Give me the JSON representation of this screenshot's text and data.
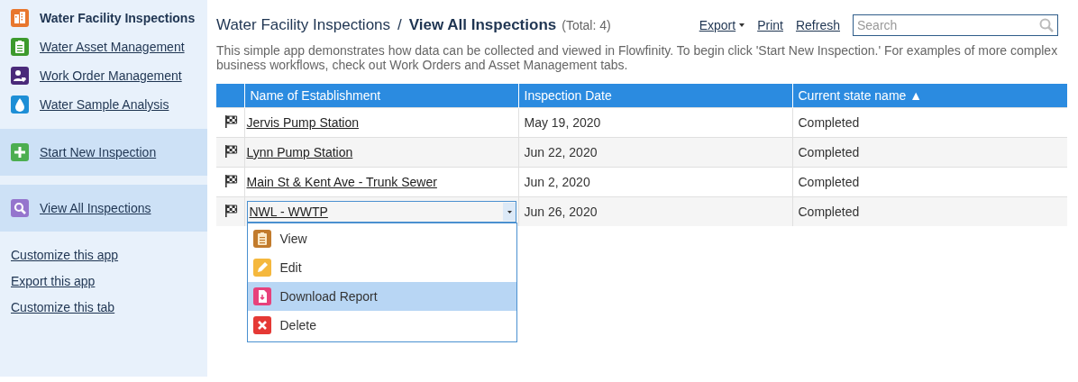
{
  "sidebar": {
    "apps": [
      {
        "label": "Water Facility Inspections",
        "kind": "building",
        "color": "#e8772e",
        "selected": true
      },
      {
        "label": "Water Asset Management",
        "kind": "clipboard",
        "color": "#3d9a2d",
        "selected": false
      },
      {
        "label": "Work Order Management",
        "kind": "person",
        "color": "#4a2a7a",
        "selected": false
      },
      {
        "label": "Water Sample Analysis",
        "kind": "drop",
        "color": "#1e8fd6",
        "selected": false
      }
    ],
    "actions": [
      {
        "label": "Start New Inspection",
        "kind": "add",
        "color": "#4cae50"
      },
      {
        "label": "View All Inspections",
        "kind": "search",
        "color": "#9575cd"
      }
    ],
    "links": [
      "Customize this app",
      "Export this app",
      "Customize this tab"
    ]
  },
  "header": {
    "breadcrumb": "Water Facility Inspections",
    "separator": "/",
    "title": "View All Inspections",
    "total": "(Total: 4)",
    "toolbar": [
      {
        "label": "Export",
        "has_menu": true
      },
      {
        "label": "Print",
        "has_menu": false
      },
      {
        "label": "Refresh",
        "has_menu": false
      }
    ],
    "search": {
      "placeholder": "Search"
    },
    "description": "This simple app demonstrates how data can be collected and viewed in Flowfinity. To begin click 'Start New Inspection.' For examples of more complex business workflows, check out Work Orders and Asset Management tabs."
  },
  "table": {
    "columns": [
      {
        "label": "Name of Establishment"
      },
      {
        "label": "Inspection Date"
      },
      {
        "label": "Current state name",
        "sort": "▲"
      }
    ],
    "rows": [
      {
        "name": "Jervis Pump Station",
        "date": "May 19, 2020",
        "state": "Completed",
        "menu_open": false
      },
      {
        "name": "Lynn Pump Station",
        "date": "Jun 22, 2020",
        "state": "Completed",
        "menu_open": false
      },
      {
        "name": "Main St & Kent Ave - Trunk Sewer",
        "date": "Jun 2, 2020",
        "state": "Completed",
        "menu_open": false
      },
      {
        "name": "NWL - WWTP",
        "date": "Jun 26, 2020",
        "state": "Completed",
        "menu_open": true
      }
    ]
  },
  "row_menu": {
    "items": [
      {
        "label": "View",
        "kind": "view",
        "color": "#c27b2c",
        "selected": false
      },
      {
        "label": "Edit",
        "kind": "edit",
        "color": "#f5b83d",
        "selected": false
      },
      {
        "label": "Download Report",
        "kind": "download",
        "color": "#e7417b",
        "selected": true
      },
      {
        "label": "Delete",
        "kind": "delete",
        "color": "#e53935",
        "selected": false
      }
    ]
  }
}
